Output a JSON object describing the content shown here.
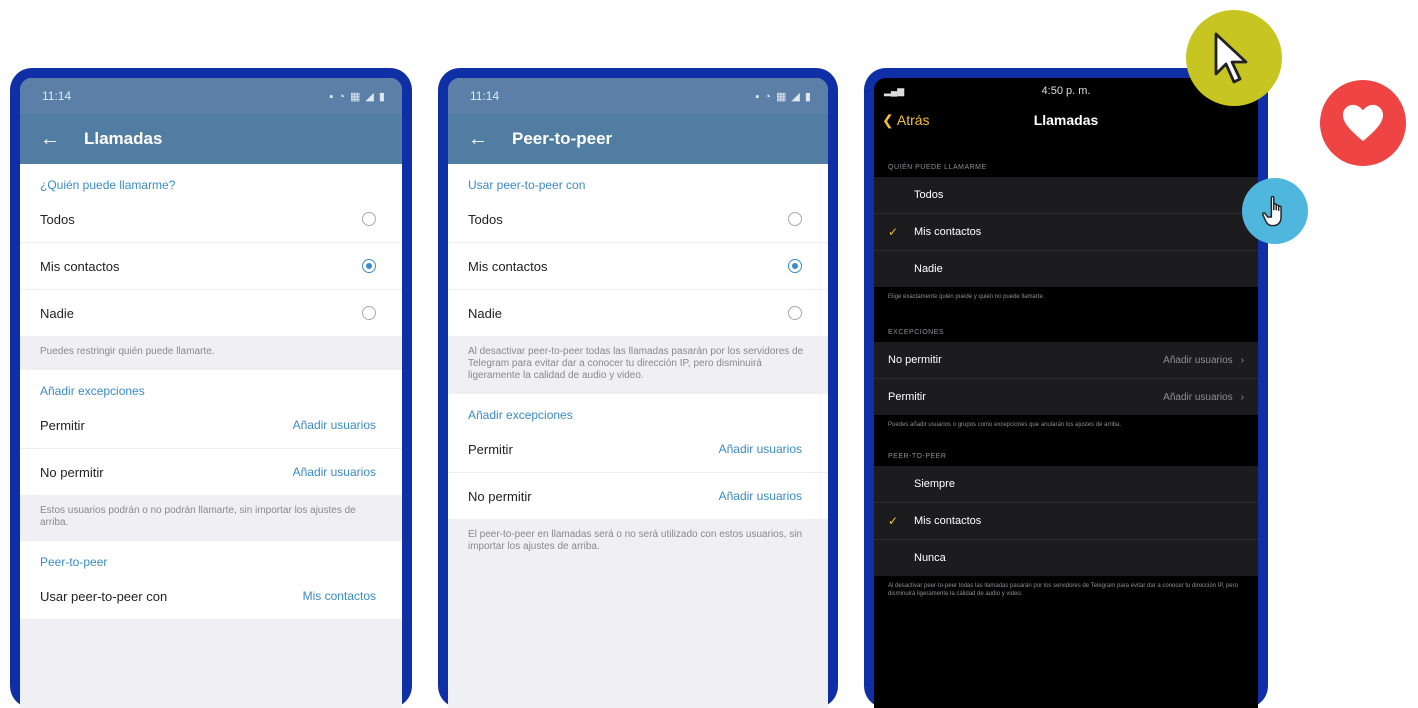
{
  "phone1": {
    "time": "11:14",
    "title": "Llamadas",
    "section1_header": "¿Quién puede llamarme?",
    "options": [
      "Todos",
      "Mis contactos",
      "Nadie"
    ],
    "note1": "Puedes restringir quién puede llamarte.",
    "section2_header": "Añadir excepciones",
    "row_permitir": "Permitir",
    "row_permitir_value": "Añadir usuarios",
    "row_no_permitir": "No permitir",
    "row_no_permitir_value": "Añadir usuarios",
    "note2": "Estos usuarios podrán o no podrán llamarte, sin importar los ajustes de arriba.",
    "section3_header": "Peer-to-peer",
    "row_p2p": "Usar peer-to-peer con",
    "row_p2p_value": "Mis contactos"
  },
  "phone2": {
    "time": "11:14",
    "title": "Peer-to-peer",
    "section1_header": "Usar peer-to-peer con",
    "options": [
      "Todos",
      "Mis contactos",
      "Nadie"
    ],
    "note1": "Al desactivar peer-to-peer todas las llamadas pasarán por los servidores de Telegram para evitar dar a conocer tu dirección IP, pero disminuirá ligeramente la calidad de audio y video.",
    "section2_header": "Añadir excepciones",
    "row_permitir": "Permitir",
    "row_permitir_value": "Añadir usuarios",
    "row_no_permitir": "No permitir",
    "row_no_permitir_value": "Añadir usuarios",
    "note2": "El peer-to-peer en llamadas será o no será utilizado con estos usuarios, sin importar los ajustes de arriba."
  },
  "phone3": {
    "time": "4:50 p. m.",
    "back": "Atrás",
    "title": "Llamadas",
    "group1_header": "QUIÉN PUEDE LLAMARME",
    "group1_options": [
      "Todos",
      "Mis contactos",
      "Nadie"
    ],
    "group1_note": "Elige exactamente quién puede y quién no puede llamarte.",
    "group2_header": "EXCEPCIONES",
    "row_no_permitir": "No permitir",
    "row_no_permitir_value": "Añadir usuarios",
    "row_permitir": "Permitir",
    "row_permitir_value": "Añadir usuarios",
    "group2_note": "Puedes añadir usuarios o grupos como excepciones que anularán los ajustes de arriba.",
    "group3_header": "PEER-TO-PEER",
    "group3_options": [
      "Siempre",
      "Mis contactos",
      "Nunca"
    ],
    "group3_note": "Al desactivar peer-to-peer todas las llamadas pasarán por los servidores de Telegram para evitar dar a conocer tu dirección IP, pero disminuirá ligeramente la calidad de audio y video."
  },
  "icons": {
    "arrow_cursor": "arrow-cursor-icon",
    "hand_cursor": "hand-pointer-icon",
    "heart": "heart-icon"
  },
  "colors": {
    "frame": "#0f2fa6",
    "accent": "#3a8bc7",
    "ios_accent": "#f2c12e",
    "cursor_badge": "#c7c521",
    "heart_badge": "#ef4444",
    "hand_badge": "#4fb6de"
  }
}
